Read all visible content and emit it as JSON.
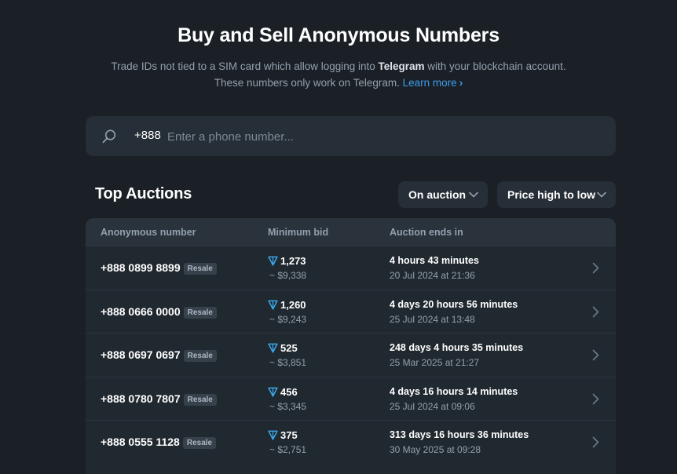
{
  "hero": {
    "title": "Buy and Sell Anonymous Numbers",
    "sub_part1": "Trade IDs not tied to a SIM card which allow logging into ",
    "sub_bold": "Telegram",
    "sub_part2": " with your blockchain account.",
    "sub_line2": "These numbers only work on Telegram. ",
    "learn_more": "Learn more"
  },
  "search": {
    "prefix": "+888",
    "placeholder": "Enter a phone number..."
  },
  "section": {
    "title": "Top Auctions"
  },
  "filters": {
    "status": "On auction",
    "sort": "Price high to low"
  },
  "table": {
    "headers": [
      "Anonymous number",
      "Minimum bid",
      "Auction ends in"
    ],
    "rows": [
      {
        "number": "+888 0899 8899",
        "badge": "Resale",
        "bid": "1,273",
        "usd": "~ $9,338",
        "ends": "4 hours 43 minutes",
        "date": "20 Jul 2024 at 21:36"
      },
      {
        "number": "+888 0666 0000",
        "badge": "Resale",
        "bid": "1,260",
        "usd": "~ $9,243",
        "ends": "4 days 20 hours 56 minutes",
        "date": "25 Jul 2024 at 13:48"
      },
      {
        "number": "+888 0697 0697",
        "badge": "Resale",
        "bid": "525",
        "usd": "~ $3,851",
        "ends": "248 days 4 hours 35 minutes",
        "date": "25 Mar 2025 at 21:27"
      },
      {
        "number": "+888 0780 7807",
        "badge": "Resale",
        "bid": "456",
        "usd": "~ $3,345",
        "ends": "4 days 16 hours 14 minutes",
        "date": "25 Jul 2024 at 09:06"
      },
      {
        "number": "+888 0555 1128",
        "badge": "Resale",
        "bid": "375",
        "usd": "~ $2,751",
        "ends": "313 days 16 hours 36 minutes",
        "date": "30 May 2025 at 09:28"
      }
    ]
  },
  "colors": {
    "background": "#1a2026",
    "panel": "#262e37",
    "accent": "#3e9dec",
    "ton": "#39a8e8",
    "muted": "#93a0ad"
  }
}
